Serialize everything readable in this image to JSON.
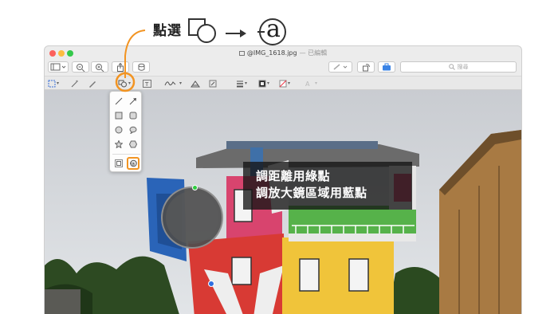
{
  "annotation": {
    "label": "點選",
    "result_glyph": "a"
  },
  "window": {
    "title": "@IMG_1618.jpg",
    "edited_label": "— 已編輯",
    "search_placeholder": "搜尋"
  },
  "toolbar": {
    "zoom_out_label": "−",
    "zoom_in_label": "+"
  },
  "shape_menu": {
    "items": [
      "line",
      "arrow",
      "rectangle",
      "rounded-rectangle",
      "oval",
      "speech-bubble",
      "star",
      "hexagon",
      "mask",
      "loupe"
    ],
    "selected": "loupe"
  },
  "caption": {
    "line1": "調距離用綠點",
    "line2": "調放大鏡區域用藍點"
  },
  "colors": {
    "accent_orange": "#f29422",
    "handle_green": "#2ecc40",
    "handle_blue": "#2f6fe0",
    "caption_bg": "#1c1c1c"
  }
}
